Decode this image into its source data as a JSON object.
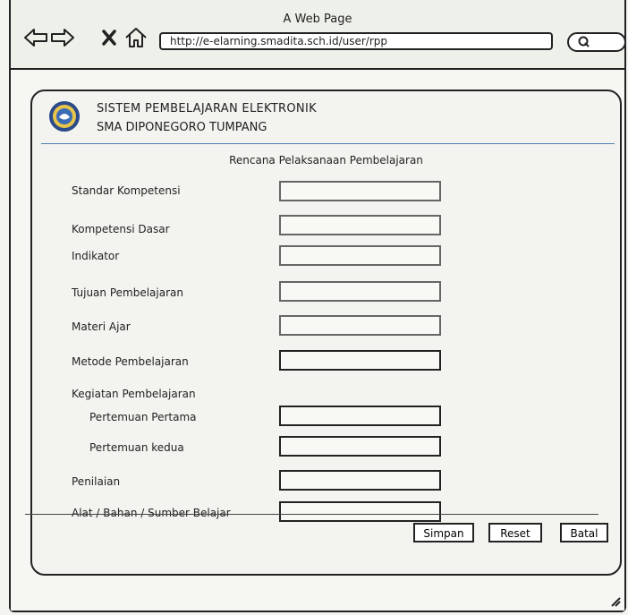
{
  "window": {
    "title": "A Web Page"
  },
  "toolbar": {
    "back_icon": "back-arrow-icon",
    "forward_icon": "forward-arrow-icon",
    "stop_icon": "close-icon",
    "home_icon": "home-icon",
    "url": "http://e-elarning.smadita.sch.id/user/rpp",
    "search_icon": "search-icon"
  },
  "header": {
    "system_title": "SISTEM PEMBELAJARAN ELEKTRONIK",
    "school_name": "SMA DIPONEGORO TUMPANG"
  },
  "form": {
    "title": "Rencana Pelaksanaan Pembelajaran",
    "fields": [
      {
        "label": "Standar Kompetensi",
        "value": ""
      },
      {
        "label": "Kompetensi Dasar",
        "value": ""
      },
      {
        "label": "Indikator",
        "value": ""
      },
      {
        "label": "Tujuan Pembelajaran",
        "value": ""
      },
      {
        "label": "Materi Ajar",
        "value": ""
      },
      {
        "label": "Metode Pembelajaran",
        "value": ""
      },
      {
        "label": "Kegiatan Pembelajaran"
      },
      {
        "label": "Pertemuan Pertama",
        "value": ""
      },
      {
        "label": "Pertemuan kedua",
        "value": ""
      },
      {
        "label": "Penilaian",
        "value": ""
      },
      {
        "label": "Alat / Bahan / Sumber Belajar",
        "value": ""
      }
    ]
  },
  "buttons": {
    "save": "Simpan",
    "reset": "Reset",
    "cancel": "Batal"
  }
}
